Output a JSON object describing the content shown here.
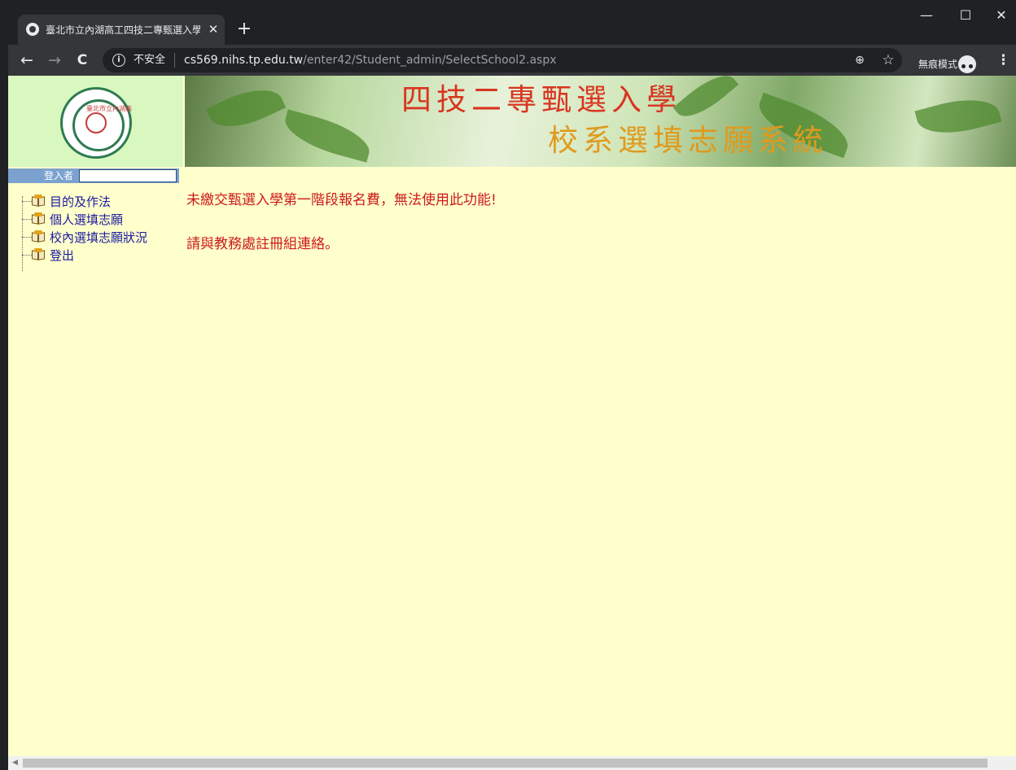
{
  "browser": {
    "tab_title": "臺北市立內湖高工四技二專甄選入學",
    "tab_close": "✕",
    "new_tab": "+",
    "window_controls": {
      "minimize": "—",
      "maximize": "☐",
      "close": "✕"
    },
    "nav": {
      "back": "←",
      "forward": "→",
      "reload": "C"
    },
    "security_label": "不安全",
    "url_host": "cs569.nihs.tp.edu.tw",
    "url_path": "/enter42/Student_admin/SelectSchool2.aspx",
    "incognito_label": "無痕模式",
    "icons": {
      "info": "i",
      "zoom": "⊕",
      "star": "☆",
      "menu": "⋮"
    }
  },
  "header": {
    "seal_text": "臺北市立內湖高工",
    "banner_line1": "四技二專甄選入學",
    "banner_line2": "校系選填志願系統"
  },
  "sidebar": {
    "login_label": "登入者",
    "login_value": "",
    "items": [
      {
        "label": "目的及作法"
      },
      {
        "label": "個人選填志願"
      },
      {
        "label": "校內選填志願狀況"
      },
      {
        "label": "登出"
      }
    ]
  },
  "main": {
    "message_1": "未繳交甄選入學第一階段報名費，無法使用此功能!",
    "message_2": "請與教務處註冊組連絡。"
  },
  "colors": {
    "page_bg": "#ffffcc",
    "message": "#cc1a1a",
    "link": "#1a1aa0",
    "banner_title_1": "#d93520",
    "banner_title_2": "#e09a1c"
  }
}
